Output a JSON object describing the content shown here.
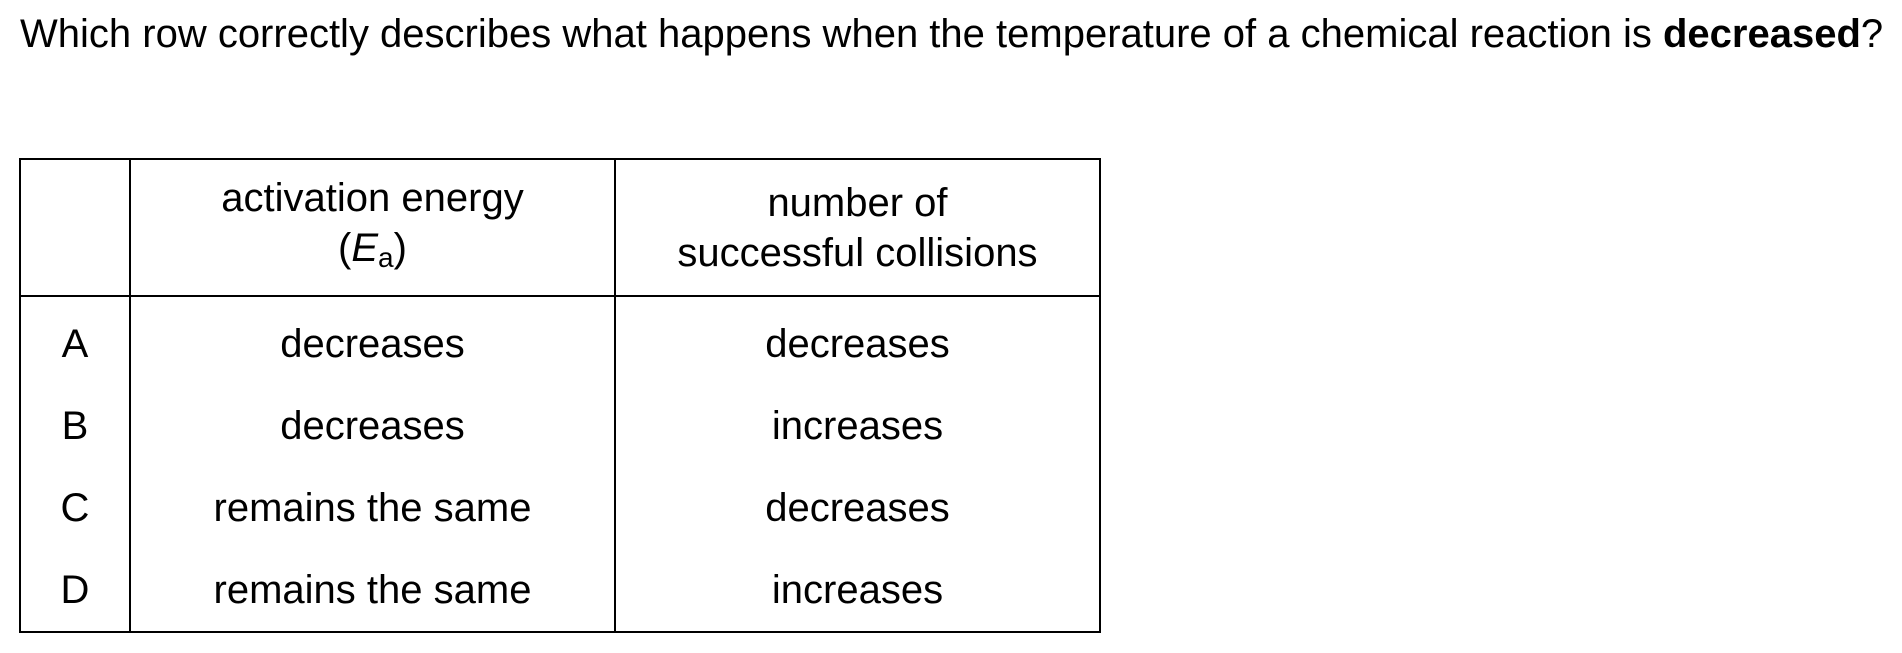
{
  "question": {
    "text_before": "Which row correctly describes what happens when the temperature of a chemical reaction is ",
    "emphasis": "decreased",
    "text_after": "?"
  },
  "table": {
    "headers": {
      "key": "",
      "activation_line1": "activation energy",
      "activation_symbol_open": "(",
      "activation_symbol": "E",
      "activation_symbol_sub": "a",
      "activation_symbol_close": ")",
      "collisions_line1": "number of",
      "collisions_line2": "successful collisions"
    },
    "rows": [
      {
        "key": "A",
        "activation_energy": "decreases",
        "successful_collisions": "decreases"
      },
      {
        "key": "B",
        "activation_energy": "decreases",
        "successful_collisions": "increases"
      },
      {
        "key": "C",
        "activation_energy": "remains the same",
        "successful_collisions": "decreases"
      },
      {
        "key": "D",
        "activation_energy": "remains the same",
        "successful_collisions": "increases"
      }
    ]
  }
}
